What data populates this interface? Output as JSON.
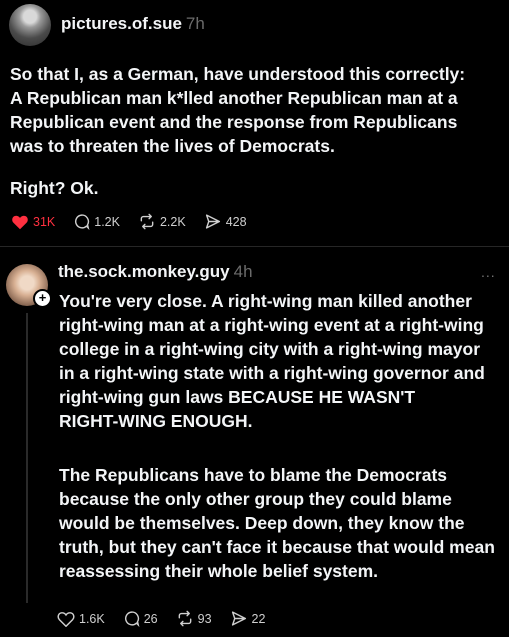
{
  "post1": {
    "username": "pictures.of.sue",
    "time": "7h",
    "lines": [
      "So that I, as a German, have understood this correctly:",
      "A Republican man k*lled another Republican man at a",
      "Republican event and the response from Republicans",
      "was to threaten the lives of Democrats."
    ],
    "followup": "Right? Ok.",
    "actions": {
      "likes": "31K",
      "comments": "1.2K",
      "reposts": "2.2K",
      "shares": "428"
    },
    "liked": true,
    "like_color": "#ff3040"
  },
  "post2": {
    "username": "the.sock.monkey.guy",
    "time": "4h",
    "more_label": "...",
    "para1_lines": [
      "You're very close. A right-wing man killed another",
      "right-wing man at a right-wing event at a right-wing",
      "college in a right-wing city with a right-wing mayor",
      "in a right-wing state with a right-wing governor and",
      "right-wing gun laws BECAUSE HE WASN'T",
      "RIGHT-WING ENOUGH."
    ],
    "para2_lines": [
      "The Republicans have to blame the Democrats",
      "because the only other group they could blame",
      "would be themselves. Deep down, they know the",
      "truth, but they can't face it because that would mean",
      "reassessing their whole belief system."
    ],
    "actions": {
      "likes": "1.6K",
      "comments": "26",
      "reposts": "93",
      "shares": "22"
    }
  }
}
